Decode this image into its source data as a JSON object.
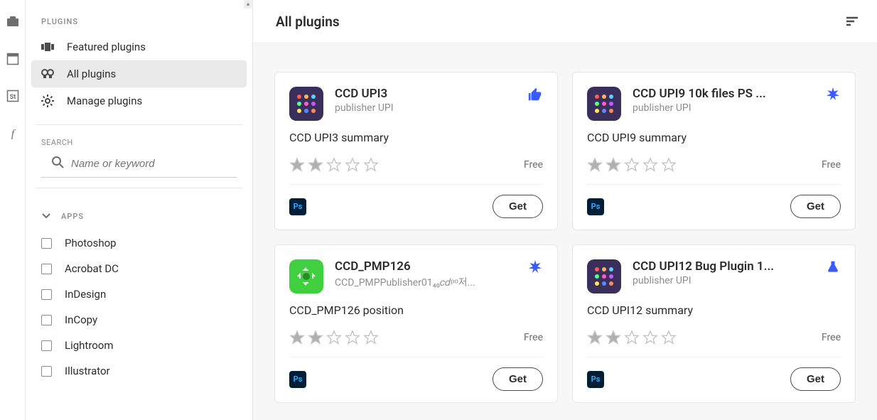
{
  "sidebar": {
    "section_label": "PLUGINS",
    "items": [
      {
        "label": "Featured plugins"
      },
      {
        "label": "All plugins"
      },
      {
        "label": "Manage plugins"
      }
    ],
    "search_label": "SEARCH",
    "search_placeholder": "Name or keyword",
    "apps_label": "APPS",
    "apps": [
      {
        "name": "Photoshop"
      },
      {
        "name": "Acrobat DC"
      },
      {
        "name": "InDesign"
      },
      {
        "name": "InCopy"
      },
      {
        "name": "Lightroom"
      },
      {
        "name": "Illustrator"
      }
    ]
  },
  "main": {
    "title": "All plugins"
  },
  "plugins": [
    {
      "title": "CCD UPI3",
      "publisher": "publisher UPI",
      "summary": "CCD UPI3 summary",
      "rating": 2,
      "price": "Free",
      "get": "Get",
      "host": "Ps",
      "featured": "thumb",
      "icon": "purple"
    },
    {
      "title": "CCD UPI9 10k files PS ...",
      "publisher": "publisher UPI",
      "summary": "CCD UPI9 summary",
      "rating": 2,
      "price": "Free",
      "get": "Get",
      "host": "Ps",
      "featured": "burst",
      "icon": "purple"
    },
    {
      "title": "CCD_PMP126",
      "publisher": "CCD_PMPPublisher01₄₀𝑐𝑑ᵖᵒ저...",
      "summary": "CCD_PMP126 position",
      "rating": 2,
      "price": "Free",
      "get": "Get",
      "host": "Ps",
      "featured": "burst",
      "icon": "green"
    },
    {
      "title": "CCD UPI12 Bug Plugin 1...",
      "publisher": "publisher UPI",
      "summary": "CCD UPI12 summary",
      "rating": 2,
      "price": "Free",
      "get": "Get",
      "host": "Ps",
      "featured": "flask",
      "icon": "purple"
    }
  ]
}
